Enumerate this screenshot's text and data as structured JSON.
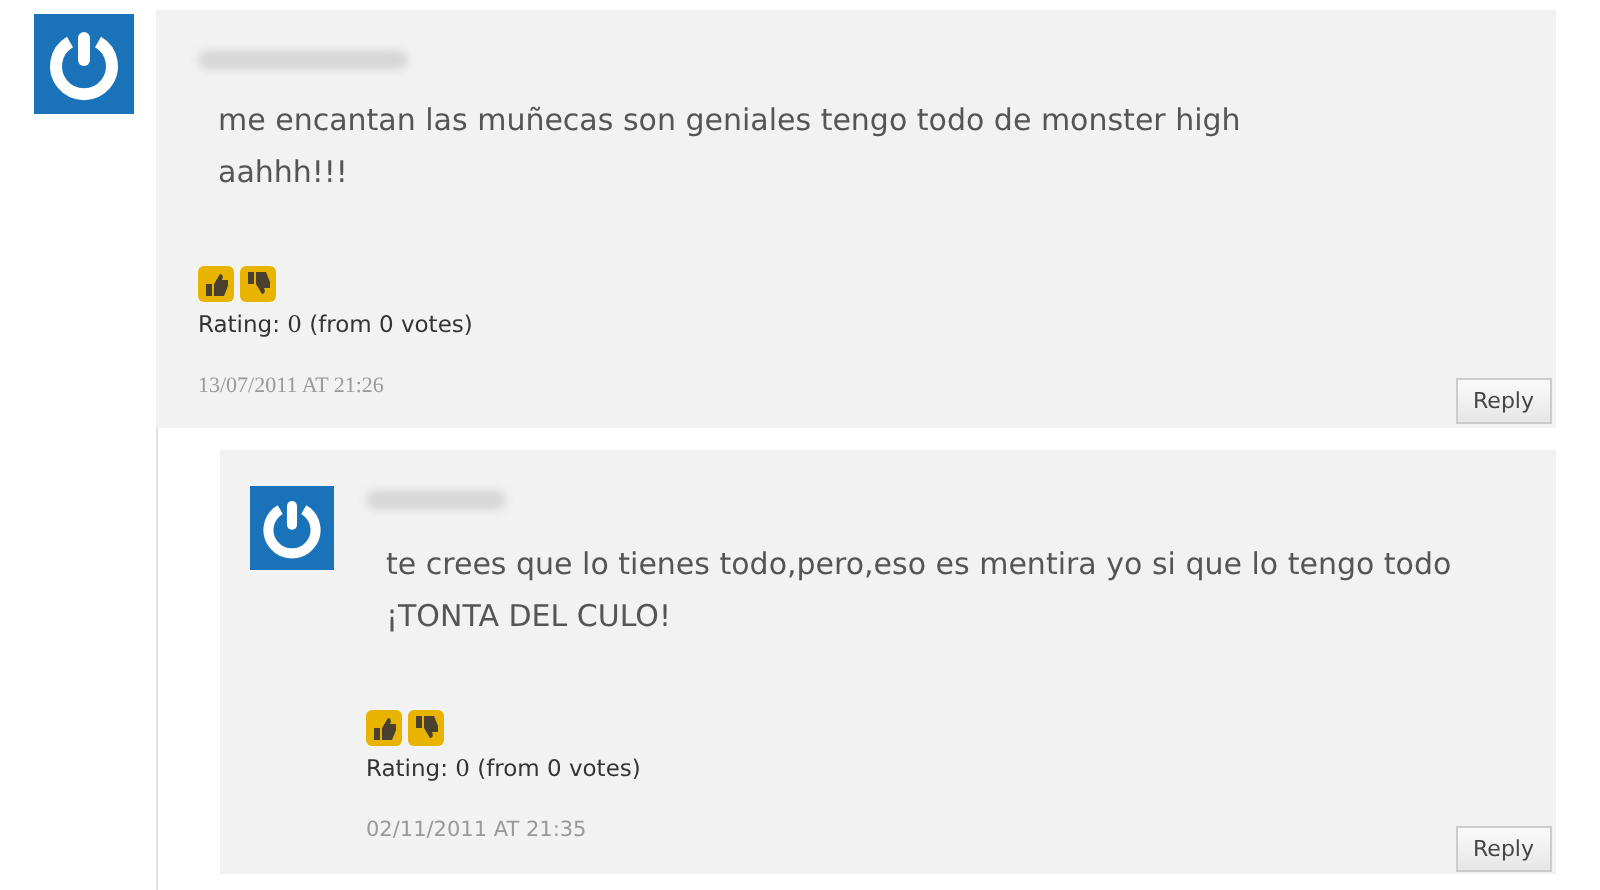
{
  "comments": [
    {
      "text": "me encantan las muñecas son geniales tengo todo de monster high\naahhh!!!",
      "rating_label": "Rating:",
      "rating_value": "0",
      "votes": "(from 0 votes)",
      "date": "13/07/2011 AT 21:26",
      "reply": "Reply",
      "children": [
        {
          "text": "te crees que lo tienes todo,pero,eso es mentira yo si que lo tengo todo\n¡TONTA DEL CULO!",
          "rating_label": "Rating:",
          "rating_value": "0",
          "votes": "(from 0 votes)",
          "date": "02/11/2011 AT 21:35",
          "reply": "Reply"
        }
      ]
    }
  ]
}
